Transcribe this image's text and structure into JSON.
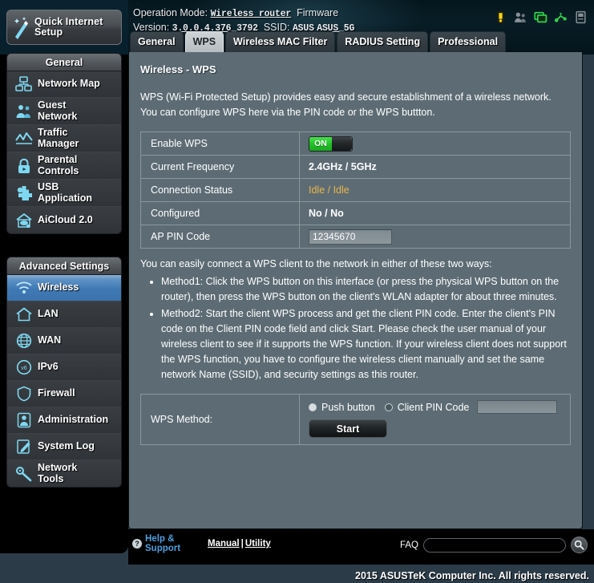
{
  "header": {
    "operation_mode_label": "Operation Mode:",
    "operation_mode_value": "Wireless router",
    "firmware_label": "Firmware Version:",
    "firmware_value": "3.0.0.4.376_3792",
    "ssid_label": "SSID:",
    "ssid_value_1": "ASUS",
    "ssid_value_2": "ASUS_5G",
    "status_icons": [
      {
        "name": "alert-icon",
        "color": "#f5d417"
      },
      {
        "name": "guest-users-icon",
        "color": "#8a9096"
      },
      {
        "name": "network-monitor-icon",
        "color": "#2fd44a"
      },
      {
        "name": "usb-icon",
        "color": "#2fd44a"
      },
      {
        "name": "printer-icon",
        "color": "#8a9096"
      }
    ]
  },
  "quick_setup": {
    "label_line1": "Quick Internet",
    "label_line2": "Setup"
  },
  "sidebar": {
    "general": {
      "title": "General",
      "items": [
        {
          "label": "Network Map",
          "icon": "network-map-icon"
        },
        {
          "label": "Guest Network",
          "icon": "guest-network-icon"
        },
        {
          "label": "Traffic Manager",
          "icon": "traffic-manager-icon"
        },
        {
          "label": "Parental Controls",
          "icon": "parental-controls-icon"
        },
        {
          "label": "USB Application",
          "icon": "usb-application-icon"
        },
        {
          "label": "AiCloud 2.0",
          "icon": "aicloud-icon"
        }
      ]
    },
    "advanced": {
      "title": "Advanced Settings",
      "items": [
        {
          "label": "Wireless",
          "icon": "wireless-icon",
          "active": true
        },
        {
          "label": "LAN",
          "icon": "lan-icon",
          "active": false
        },
        {
          "label": "WAN",
          "icon": "wan-icon",
          "active": false
        },
        {
          "label": "IPv6",
          "icon": "ipv6-icon",
          "active": false
        },
        {
          "label": "Firewall",
          "icon": "firewall-icon",
          "active": false
        },
        {
          "label": "Administration",
          "icon": "administration-icon",
          "active": false
        },
        {
          "label": "System Log",
          "icon": "system-log-icon",
          "active": false
        },
        {
          "label": "Network Tools",
          "icon": "network-tools-icon",
          "active": false
        }
      ]
    }
  },
  "tabs": [
    {
      "label": "General",
      "active": false
    },
    {
      "label": "WPS",
      "active": true
    },
    {
      "label": "Wireless MAC Filter",
      "active": false
    },
    {
      "label": "RADIUS Setting",
      "active": false
    },
    {
      "label": "Professional",
      "active": false
    }
  ],
  "main": {
    "title": "Wireless - WPS",
    "intro": "WPS (Wi-Fi Protected Setup) provides easy and secure establishment of a wireless network. You can configure WPS here via the PIN code or the WPS buttton.",
    "settings": [
      {
        "label": "Enable WPS",
        "type": "toggle",
        "value": "ON"
      },
      {
        "label": "Current Frequency",
        "type": "text",
        "value": "2.4GHz / 5GHz"
      },
      {
        "label": "Connection Status",
        "type": "status",
        "value": "Idle / Idle"
      },
      {
        "label": "Configured",
        "type": "text",
        "value": "No / No"
      },
      {
        "label": "AP PIN Code",
        "type": "input",
        "value": "12345670"
      }
    ],
    "howto": "You can easily connect a WPS client to the network in either of these two ways:",
    "methods": [
      "Method1: Click the WPS button on this interface (or press the physical WPS button on the router), then press the WPS button on the client's WLAN adapter for about three minutes.",
      "Method2: Start the client WPS process and get the client PIN code. Enter the client's PIN code on the Client PIN code field and click Start. Please check the user manual of your wireless client to see if it supports the WPS function. If your wireless client does not support the WPS function, you have to configure the wireless client manually and set the same network Name (SSID), and security settings as this router."
    ],
    "wps_method": {
      "label": "WPS Method:",
      "option_push": "Push button",
      "option_pin": "Client PIN Code",
      "push_selected": true,
      "pin_selected": false,
      "client_pin_value": "",
      "start_label": "Start"
    }
  },
  "footer": {
    "help_line1": "Help &",
    "help_line2": "Support",
    "manual": "Manual",
    "separator": "|",
    "utility": "Utility",
    "faq_label": "FAQ",
    "faq_value": "",
    "copyright": "2015 ASUSTeK Computer Inc. All rights reserved."
  },
  "colors": {
    "accent_blue": "#3f79b4",
    "status_amber": "#e8b54a",
    "toggle_green": "#23c22a",
    "panel_bg": "#5d6c74"
  }
}
